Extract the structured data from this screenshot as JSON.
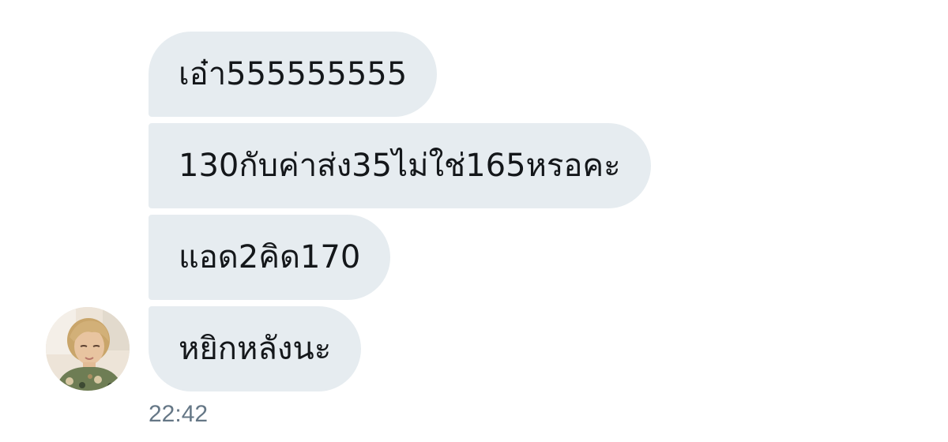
{
  "conversation": {
    "messages": [
      {
        "text": "เอ๋า555555555"
      },
      {
        "text": "130กับค่าส่ง35ไม่ใช่165หรอคะ"
      },
      {
        "text": "แอด2คิด170"
      },
      {
        "text": "หยิกหลังนะ"
      }
    ],
    "timestamp": "22:42"
  },
  "colors": {
    "bubble_background": "#e6ecf0",
    "message_text": "#14171a",
    "timestamp_text": "#657786"
  },
  "icons": {
    "sender_avatar": "profile-photo"
  }
}
